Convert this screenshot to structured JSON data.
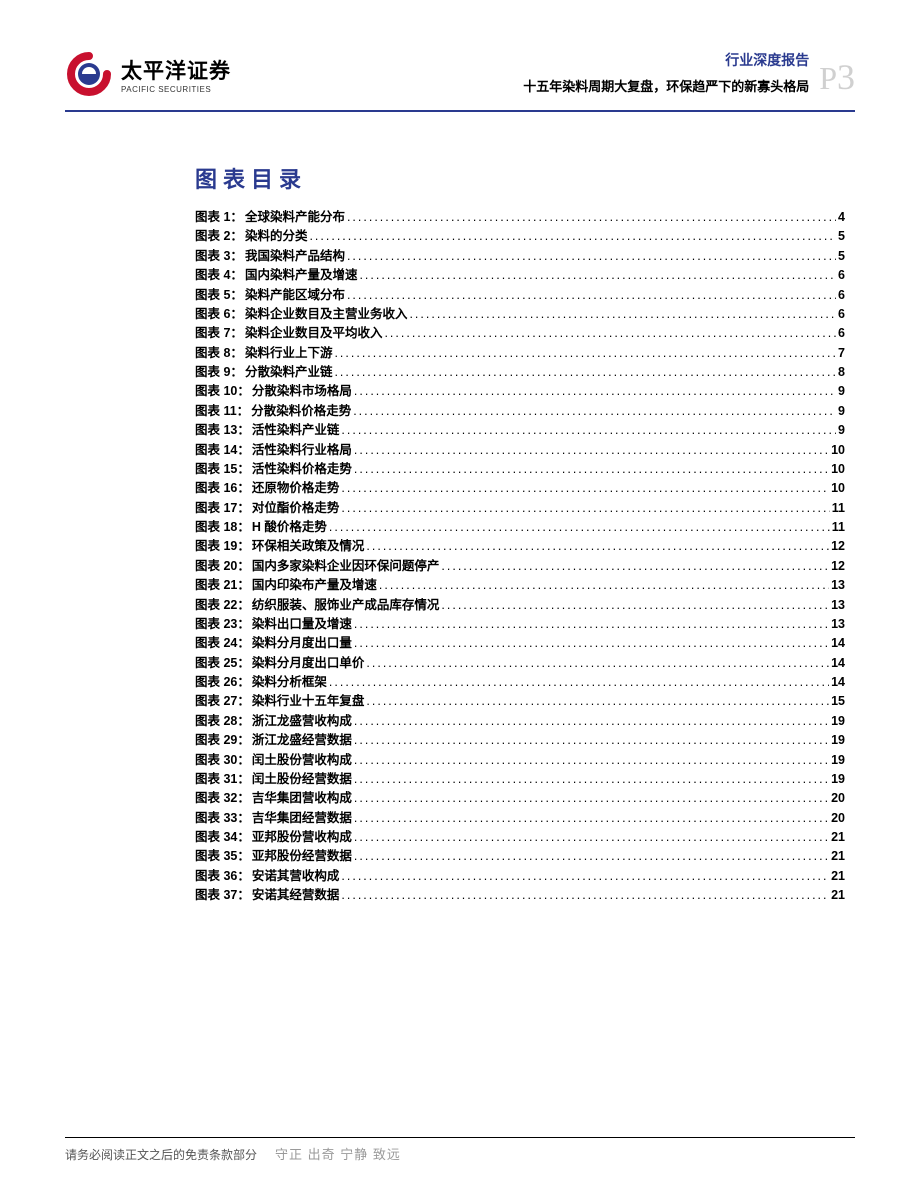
{
  "header": {
    "logo_cn": "太平洋证券",
    "logo_en": "PACIFIC SECURITIES",
    "report_type": "行业深度报告",
    "report_title": "十五年染料周期大复盘，环保趋严下的新寡头格局",
    "page_prefix": "P",
    "page_num": "3"
  },
  "toc": {
    "heading": "图表目录",
    "entries": [
      {
        "label": "图表 1：",
        "title": "全球染料产能分布",
        "page": "4"
      },
      {
        "label": "图表 2：",
        "title": "染料的分类",
        "page": "5"
      },
      {
        "label": "图表 3：",
        "title": "我国染料产品结构",
        "page": "5"
      },
      {
        "label": "图表 4：",
        "title": "国内染料产量及增速",
        "page": "6"
      },
      {
        "label": "图表 5：",
        "title": "染料产能区域分布",
        "page": "6"
      },
      {
        "label": "图表 6：",
        "title": "染料企业数目及主营业务收入",
        "page": "6"
      },
      {
        "label": "图表 7：",
        "title": "染料企业数目及平均收入",
        "page": "6"
      },
      {
        "label": "图表 8：",
        "title": "染料行业上下游",
        "page": "7"
      },
      {
        "label": "图表 9：",
        "title": "分散染料产业链",
        "page": "8"
      },
      {
        "label": "图表 10：",
        "title": "分散染料市场格局",
        "page": "9"
      },
      {
        "label": "图表 11：",
        "title": "分散染料价格走势",
        "page": "9"
      },
      {
        "label": "图表 13：",
        "title": "活性染料产业链",
        "page": "9"
      },
      {
        "label": "图表 14：",
        "title": "活性染料行业格局",
        "page": "10"
      },
      {
        "label": "图表 15：",
        "title": "活性染料价格走势",
        "page": "10"
      },
      {
        "label": "图表 16：",
        "title": "还原物价格走势",
        "page": "10"
      },
      {
        "label": "图表 17：",
        "title": "对位酯价格走势",
        "page": "11"
      },
      {
        "label": "图表 18：",
        "title": "H 酸价格走势",
        "page": "11"
      },
      {
        "label": "图表 19：",
        "title": "环保相关政策及情况",
        "page": "12"
      },
      {
        "label": "图表 20：",
        "title": "国内多家染料企业因环保问题停产",
        "page": "12"
      },
      {
        "label": "图表 21：",
        "title": "国内印染布产量及增速",
        "page": "13"
      },
      {
        "label": "图表 22：",
        "title": "纺织服装、服饰业产成品库存情况",
        "page": "13"
      },
      {
        "label": "图表 23：",
        "title": "染料出口量及增速",
        "page": "13"
      },
      {
        "label": "图表 24：",
        "title": "染料分月度出口量",
        "page": "14"
      },
      {
        "label": "图表 25：",
        "title": "染料分月度出口单价",
        "page": "14"
      },
      {
        "label": "图表 26：",
        "title": "染料分析框架",
        "page": "14"
      },
      {
        "label": "图表 27：",
        "title": "染料行业十五年复盘",
        "page": "15"
      },
      {
        "label": "图表 28：",
        "title": "浙江龙盛营收构成",
        "page": "19"
      },
      {
        "label": "图表 29：",
        "title": "浙江龙盛经营数据",
        "page": "19"
      },
      {
        "label": "图表 30：",
        "title": "闰土股份营收构成",
        "page": "19"
      },
      {
        "label": "图表 31：",
        "title": "闰土股份经营数据",
        "page": "19"
      },
      {
        "label": "图表 32：",
        "title": "吉华集团营收构成",
        "page": "20"
      },
      {
        "label": "图表 33：",
        "title": "吉华集团经营数据",
        "page": "20"
      },
      {
        "label": "图表 34：",
        "title": "亚邦股份营收构成",
        "page": "21"
      },
      {
        "label": "图表 35：",
        "title": "亚邦股份经营数据",
        "page": "21"
      },
      {
        "label": "图表 36：",
        "title": "安诺其营收构成",
        "page": "21"
      },
      {
        "label": "图表 37：",
        "title": "安诺其经营数据",
        "page": "21"
      }
    ]
  },
  "footer": {
    "disclaimer": "请务必阅读正文之后的免责条款部分",
    "motto": "守正 出奇 宁静 致远"
  }
}
